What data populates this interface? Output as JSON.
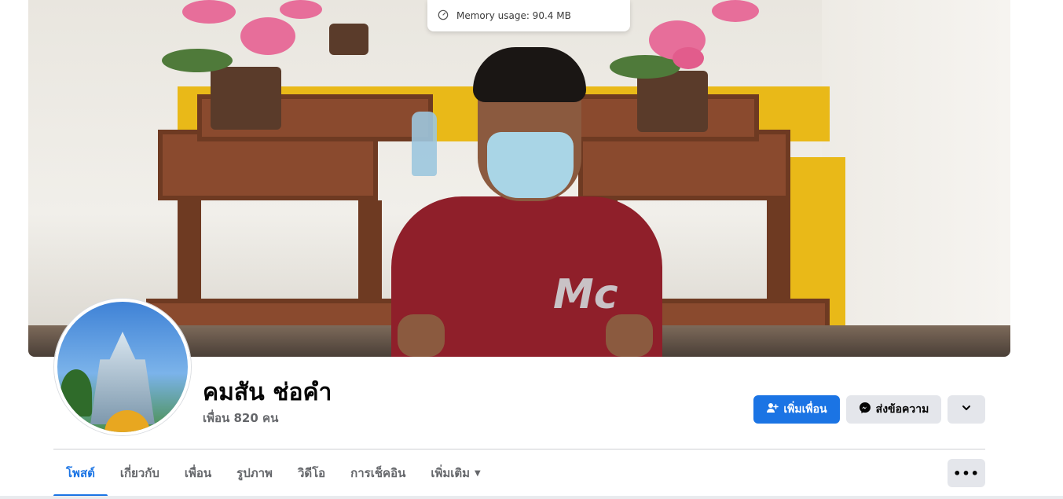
{
  "memory_tooltip": {
    "text": "Memory usage: 90.4 MB",
    "icon": "gauge-icon"
  },
  "profile": {
    "name": "คมสัน ช่อคำ",
    "friends_count": "เพื่อน 820 คน"
  },
  "actions": {
    "add_friend": "เพิ่มเพื่อน",
    "message": "ส่งข้อความ",
    "more_icon": "chevron-down-icon"
  },
  "tabs": [
    {
      "label": "โพสต์",
      "active": true
    },
    {
      "label": "เกี่ยวกับ"
    },
    {
      "label": "เพื่อน"
    },
    {
      "label": "รูปภาพ"
    },
    {
      "label": "วิดีโอ"
    },
    {
      "label": "การเช็คอิน"
    },
    {
      "label": "เพิ่มเติม",
      "caret": "▼"
    }
  ],
  "tab_options_label": "•••",
  "colors": {
    "accent": "#1b74e4",
    "secondary_btn": "#e4e6eb",
    "muted_text": "#65676b"
  },
  "cover_logo_text": "Mc"
}
